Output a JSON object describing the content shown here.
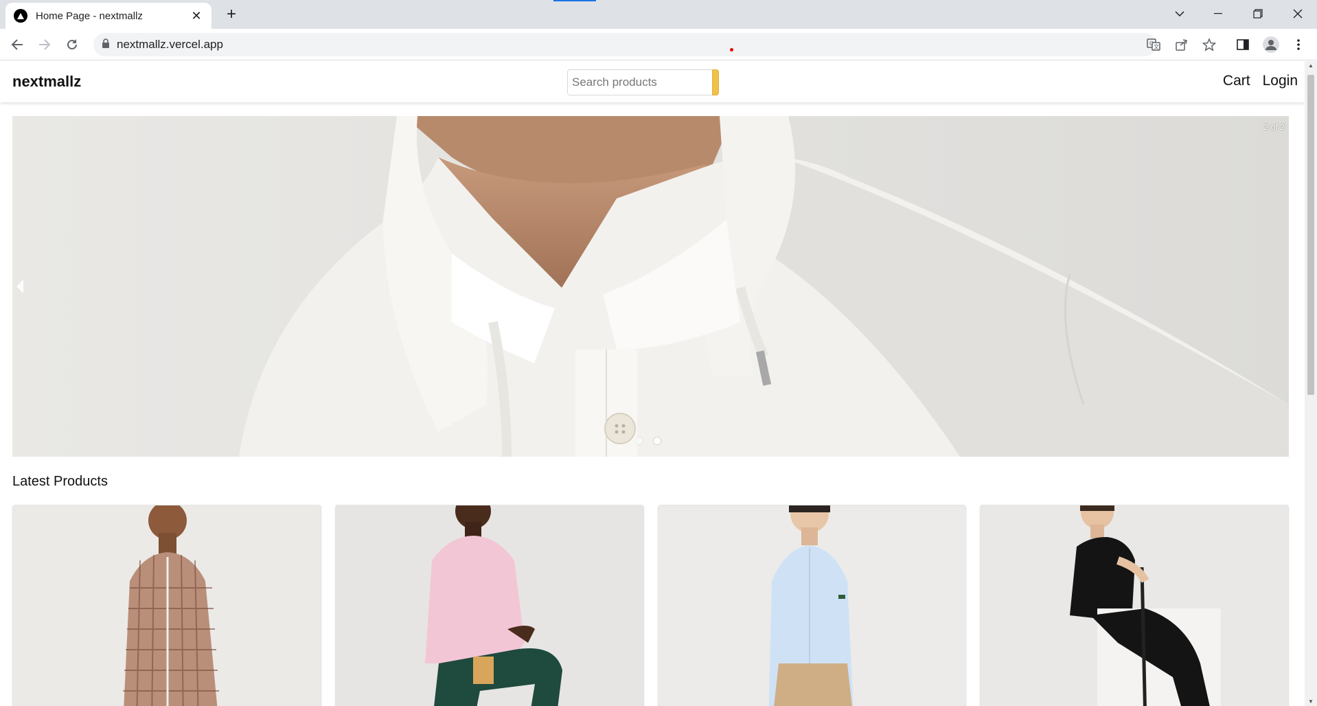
{
  "browser": {
    "tab_title": "Home Page - nextmallz",
    "url": "nextmallz.vercel.app"
  },
  "header": {
    "brand": "nextmallz",
    "search_placeholder": "Search products",
    "cart_label": "Cart",
    "login_label": "Login"
  },
  "carousel": {
    "counter": "2 of 2",
    "slides": 2,
    "active_slide": 2
  },
  "latest": {
    "title": "Latest Products",
    "products": [
      {
        "shirt": "#b98f7a",
        "pants": "#e8e4dc",
        "skin": "#8d5a3b"
      },
      {
        "shirt": "#f3c6d6",
        "pants": "#1f4a3e",
        "skin": "#4a2c1d"
      },
      {
        "shirt": "#cfe2f5",
        "pants": "#cfae86",
        "skin": "#e8c6a8"
      },
      {
        "shirt": "#141414",
        "pants": "#141414",
        "skin": "#e6c2a2"
      }
    ]
  },
  "colors": {
    "search_button": "#f0c14b",
    "loading_bar": "#1a73e8"
  }
}
